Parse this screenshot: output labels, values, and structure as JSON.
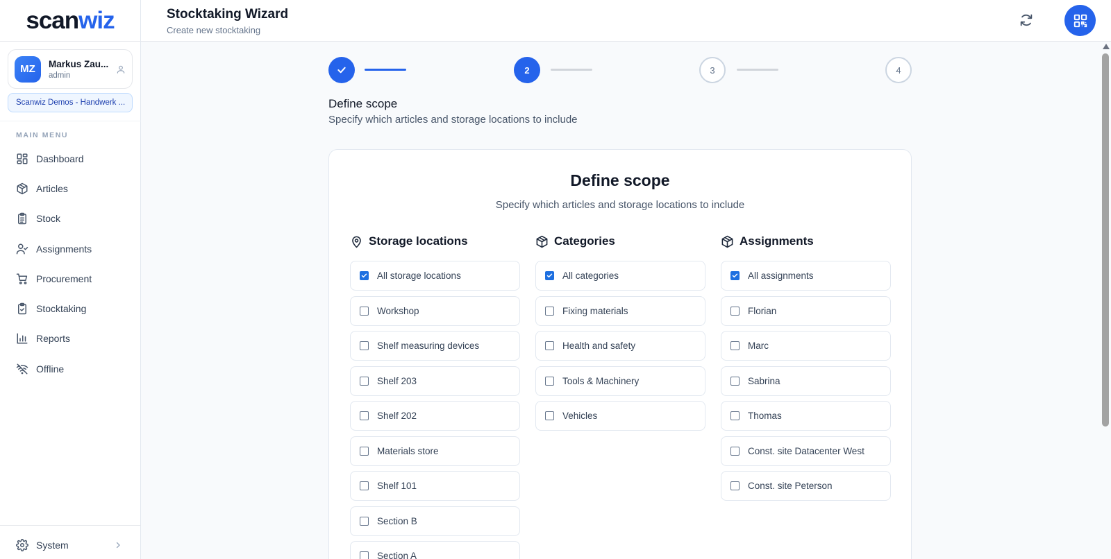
{
  "brand": {
    "part1": "scan",
    "part2": "wiz"
  },
  "user": {
    "initials": "MZ",
    "name": "Markus Zau...",
    "role": "admin"
  },
  "org": "Scanwiz Demos - Handwerk ...",
  "menu": {
    "title": "MAIN MENU",
    "items": [
      {
        "label": "Dashboard",
        "icon": "dashboard-icon"
      },
      {
        "label": "Articles",
        "icon": "box-icon"
      },
      {
        "label": "Stock",
        "icon": "clipboard-list-icon"
      },
      {
        "label": "Assignments",
        "icon": "user-check-icon"
      },
      {
        "label": "Procurement",
        "icon": "cart-icon"
      },
      {
        "label": "Stocktaking",
        "icon": "clipboard-check-icon"
      },
      {
        "label": "Reports",
        "icon": "bar-chart-icon"
      },
      {
        "label": "Offline",
        "icon": "wifi-off-icon"
      }
    ],
    "system_label": "System"
  },
  "header": {
    "title": "Stocktaking Wizard",
    "subtitle": "Create new stocktaking"
  },
  "stepper": {
    "steps": [
      {
        "label": "",
        "state": "done"
      },
      {
        "label": "2",
        "state": "active"
      },
      {
        "label": "3",
        "state": "todo"
      },
      {
        "label": "4",
        "state": "todo"
      }
    ]
  },
  "scope": {
    "title": "Define scope",
    "subtitle": "Specify which articles and storage locations to include"
  },
  "card": {
    "title": "Define scope",
    "subtitle": "Specify which articles and storage locations to include",
    "columns": [
      {
        "title": "Storage locations",
        "icon": "map-pin-icon",
        "options": [
          {
            "label": "All storage locations",
            "checked": true
          },
          {
            "label": "Workshop",
            "checked": false
          },
          {
            "label": "Shelf measuring devices",
            "checked": false
          },
          {
            "label": "Shelf 203",
            "checked": false
          },
          {
            "label": "Shelf 202",
            "checked": false
          },
          {
            "label": "Materials store",
            "checked": false
          },
          {
            "label": "Shelf 101",
            "checked": false
          },
          {
            "label": "Section B",
            "checked": false
          },
          {
            "label": "Section A",
            "checked": false
          }
        ]
      },
      {
        "title": "Categories",
        "icon": "box-icon",
        "options": [
          {
            "label": "All categories",
            "checked": true
          },
          {
            "label": "Fixing materials",
            "checked": false
          },
          {
            "label": "Health and safety",
            "checked": false
          },
          {
            "label": "Tools & Machinery",
            "checked": false
          },
          {
            "label": "Vehicles",
            "checked": false
          }
        ]
      },
      {
        "title": "Assignments",
        "icon": "box-icon",
        "options": [
          {
            "label": "All assignments",
            "checked": true
          },
          {
            "label": "Florian",
            "checked": false
          },
          {
            "label": "Marc",
            "checked": false
          },
          {
            "label": "Sabrina",
            "checked": false
          },
          {
            "label": "Thomas",
            "checked": false
          },
          {
            "label": "Const. site Datacenter West",
            "checked": false
          },
          {
            "label": "Const. site Peterson",
            "checked": false
          }
        ]
      }
    ]
  },
  "colors": {
    "accent": "#2563eb",
    "checkbox": "#1d6fe0",
    "border": "#e2e8f0"
  }
}
